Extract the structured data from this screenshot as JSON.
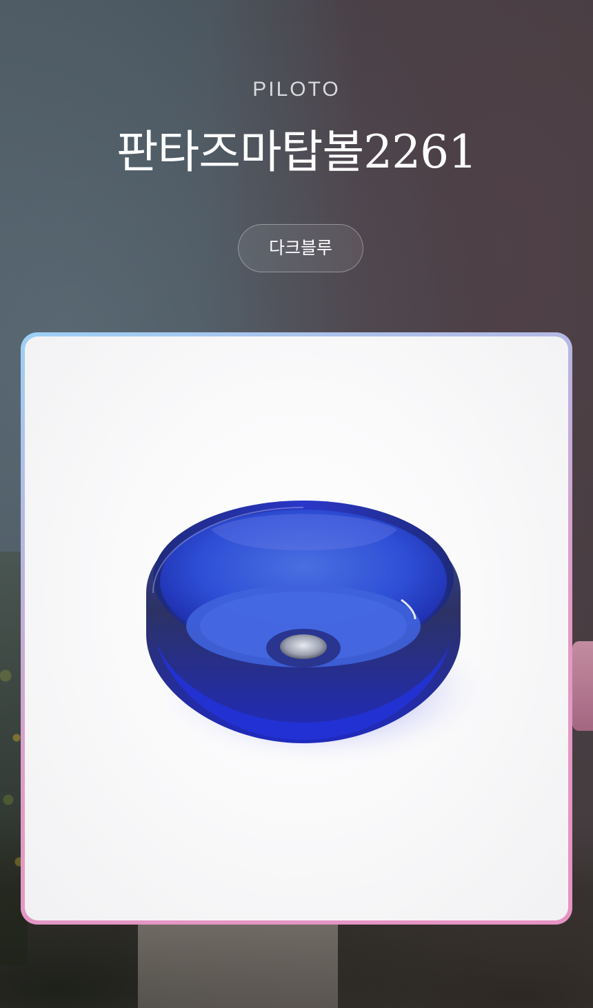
{
  "header": {
    "brand": "PILOTO",
    "product_title": "판타즈마탑볼2261",
    "color_option": "다크블루"
  },
  "product_image": {
    "icon": "blue-glass-basin",
    "color": "#2b3fd6"
  }
}
